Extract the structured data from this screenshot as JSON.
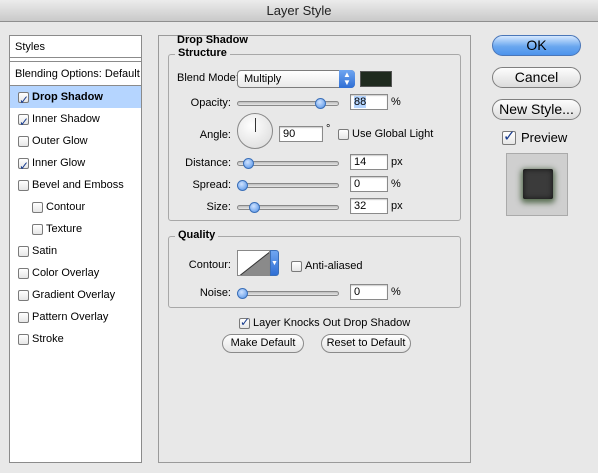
{
  "window": {
    "title": "Layer Style"
  },
  "sidebar": {
    "styles_label": "Styles",
    "blending_label": "Blending Options: Default",
    "items": [
      {
        "label": "Drop Shadow",
        "checked": true,
        "selected": true
      },
      {
        "label": "Inner Shadow",
        "checked": true
      },
      {
        "label": "Outer Glow",
        "checked": false
      },
      {
        "label": "Inner Glow",
        "checked": true
      },
      {
        "label": "Bevel and Emboss",
        "checked": false
      },
      {
        "label": "Contour",
        "checked": false,
        "sub": true
      },
      {
        "label": "Texture",
        "checked": false,
        "sub": true
      },
      {
        "label": "Satin",
        "checked": false
      },
      {
        "label": "Color Overlay",
        "checked": false
      },
      {
        "label": "Gradient Overlay",
        "checked": false
      },
      {
        "label": "Pattern Overlay",
        "checked": false
      },
      {
        "label": "Stroke",
        "checked": false
      }
    ]
  },
  "panel": {
    "title": "Drop Shadow",
    "structure": {
      "title": "Structure",
      "blend_mode_label": "Blend Mode:",
      "blend_mode_value": "Multiply",
      "shadow_color": "#1f2a1e",
      "opacity_label": "Opacity:",
      "opacity_value": "88",
      "opacity_unit": "%",
      "opacity_level": 0.88,
      "angle_label": "Angle:",
      "angle_value": "90",
      "angle_unit": "°",
      "global_light_label": "Use Global Light",
      "global_light_checked": false,
      "distance_label": "Distance:",
      "distance_value": "14",
      "distance_unit": "px",
      "distance_level": 0.07,
      "spread_label": "Spread:",
      "spread_value": "0",
      "spread_unit": "%",
      "spread_level": 0,
      "size_label": "Size:",
      "size_value": "32",
      "size_unit": "px",
      "size_level": 0.13
    },
    "quality": {
      "title": "Quality",
      "contour_label": "Contour:",
      "anti_aliased_label": "Anti-aliased",
      "anti_aliased_checked": false,
      "noise_label": "Noise:",
      "noise_value": "0",
      "noise_unit": "%",
      "noise_level": 0
    },
    "knockout_label": "Layer Knocks Out Drop Shadow",
    "knockout_checked": true,
    "make_default_label": "Make Default",
    "reset_default_label": "Reset to Default"
  },
  "actions": {
    "ok_label": "OK",
    "cancel_label": "Cancel",
    "new_style_label": "New Style...",
    "preview_label": "Preview",
    "preview_checked": true
  },
  "icons": {
    "checkbox": "checkmark-icon",
    "popup_arrows": "up-down-arrows-icon",
    "contour_arrow": "chevron-down-icon",
    "angle_dial": "angle-dial-icon"
  },
  "colors": {
    "selection": "#b5d5ff",
    "accent_blue": "#4c93ec"
  }
}
